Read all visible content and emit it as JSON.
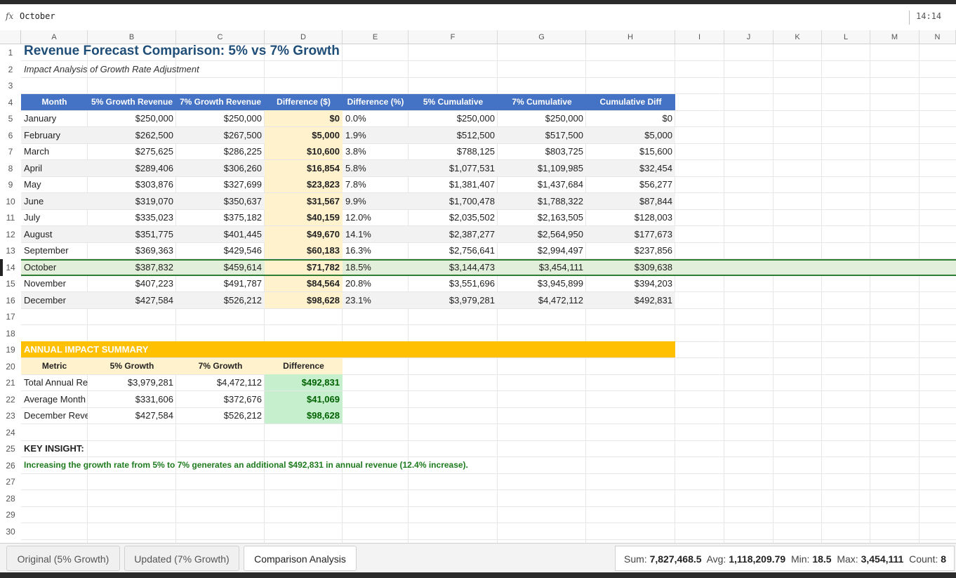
{
  "formula": {
    "fx": "fx",
    "value": "October"
  },
  "clock": "14:14",
  "columns": [
    "A",
    "B",
    "C",
    "D",
    "E",
    "F",
    "G",
    "H",
    "I",
    "J",
    "K",
    "L",
    "M",
    "N"
  ],
  "rows": [
    "1",
    "2",
    "3",
    "4",
    "5",
    "6",
    "7",
    "8",
    "9",
    "10",
    "11",
    "12",
    "13",
    "14",
    "15",
    "16",
    "17",
    "18",
    "19",
    "20",
    "21",
    "22",
    "23",
    "24",
    "25",
    "26",
    "27",
    "28",
    "29",
    "30"
  ],
  "title": "Revenue Forecast Comparison: 5% vs 7% Growth",
  "subtitle": "Impact Analysis of Growth Rate Adjustment",
  "table": {
    "headers": [
      "Month",
      "5% Growth Revenue",
      "7% Growth Revenue",
      "Difference ($)",
      "Difference (%)",
      "5% Cumulative",
      "7% Cumulative",
      "Cumulative Diff"
    ],
    "rows": [
      [
        "January",
        "$250,000",
        "$250,000",
        "$0",
        "0.0%",
        "$250,000",
        "$250,000",
        "$0"
      ],
      [
        "February",
        "$262,500",
        "$267,500",
        "$5,000",
        "1.9%",
        "$512,500",
        "$517,500",
        "$5,000"
      ],
      [
        "March",
        "$275,625",
        "$286,225",
        "$10,600",
        "3.8%",
        "$788,125",
        "$803,725",
        "$15,600"
      ],
      [
        "April",
        "$289,406",
        "$306,260",
        "$16,854",
        "5.8%",
        "$1,077,531",
        "$1,109,985",
        "$32,454"
      ],
      [
        "May",
        "$303,876",
        "$327,699",
        "$23,823",
        "7.8%",
        "$1,381,407",
        "$1,437,684",
        "$56,277"
      ],
      [
        "June",
        "$319,070",
        "$350,637",
        "$31,567",
        "9.9%",
        "$1,700,478",
        "$1,788,322",
        "$87,844"
      ],
      [
        "July",
        "$335,023",
        "$375,182",
        "$40,159",
        "12.0%",
        "$2,035,502",
        "$2,163,505",
        "$128,003"
      ],
      [
        "August",
        "$351,775",
        "$401,445",
        "$49,670",
        "14.1%",
        "$2,387,277",
        "$2,564,950",
        "$177,673"
      ],
      [
        "September",
        "$369,363",
        "$429,546",
        "$60,183",
        "16.3%",
        "$2,756,641",
        "$2,994,497",
        "$237,856"
      ],
      [
        "October",
        "$387,832",
        "$459,614",
        "$71,782",
        "18.5%",
        "$3,144,473",
        "$3,454,111",
        "$309,638"
      ],
      [
        "November",
        "$407,223",
        "$491,787",
        "$84,564",
        "20.8%",
        "$3,551,696",
        "$3,945,899",
        "$394,203"
      ],
      [
        "December",
        "$427,584",
        "$526,212",
        "$98,628",
        "23.1%",
        "$3,979,281",
        "$4,472,112",
        "$492,831"
      ]
    ]
  },
  "summary": {
    "title": "ANNUAL IMPACT SUMMARY",
    "headers": [
      "Metric",
      "5% Growth",
      "7% Growth",
      "Difference"
    ],
    "rows": [
      [
        "Total Annual Re",
        "$3,979,281",
        "$4,472,112",
        "$492,831"
      ],
      [
        "Average Month",
        "$331,606",
        "$372,676",
        "$41,069"
      ],
      [
        "December Reve",
        "$427,584",
        "$526,212",
        "$98,628"
      ]
    ]
  },
  "insight_label": "KEY INSIGHT:",
  "insight_text": "Increasing the growth rate from 5% to 7% generates an additional $492,831 in annual revenue (12.4% increase).",
  "tabs": [
    "Original (5% Growth)",
    "Updated (7% Growth)",
    "Comparison Analysis"
  ],
  "active_tab": "Comparison Analysis",
  "status": {
    "sum_label": "Sum:",
    "sum": "7,827,468.5",
    "avg_label": "Avg:",
    "avg": "1,118,209.79",
    "min_label": "Min:",
    "min": "18.5",
    "max_label": "Max:",
    "max": "3,454,111",
    "count_label": "Count:",
    "count": "8"
  },
  "colors": {
    "header_blue": "#4472c4",
    "title_blue": "#1f4e79",
    "summary_orange": "#ffc000",
    "diff_yellow": "#fff2cc",
    "selection_green": "#2e7d32"
  }
}
